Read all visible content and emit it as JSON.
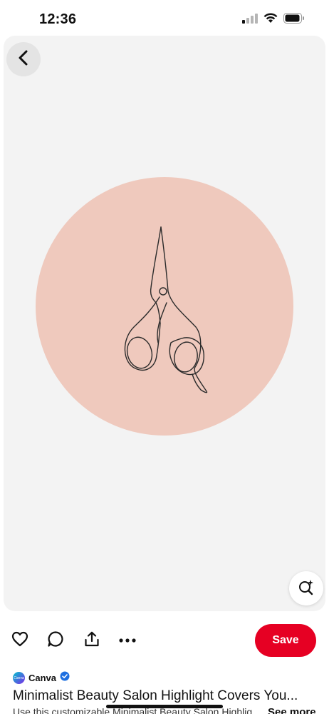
{
  "status_bar": {
    "time": "12:36",
    "icons": [
      "cellular-signal-icon",
      "wifi-icon",
      "battery-icon"
    ]
  },
  "pin": {
    "image_description_icon": "scissors-line-art-icon",
    "circle_color": "#efc9bd",
    "background_color": "#f3f3f3"
  },
  "actions": {
    "icons": [
      "heart-icon",
      "comment-icon",
      "share-icon",
      "more-icon"
    ],
    "save_label": "Save",
    "save_color": "#e60023"
  },
  "creator": {
    "avatar_text": "Canva",
    "name": "Canva",
    "verified": true
  },
  "details": {
    "title": "Minimalist Beauty Salon Highlight Covers You...",
    "description": "Use this customizable Minimalist Beauty Salon Highlig",
    "see_more_label": "See more"
  }
}
